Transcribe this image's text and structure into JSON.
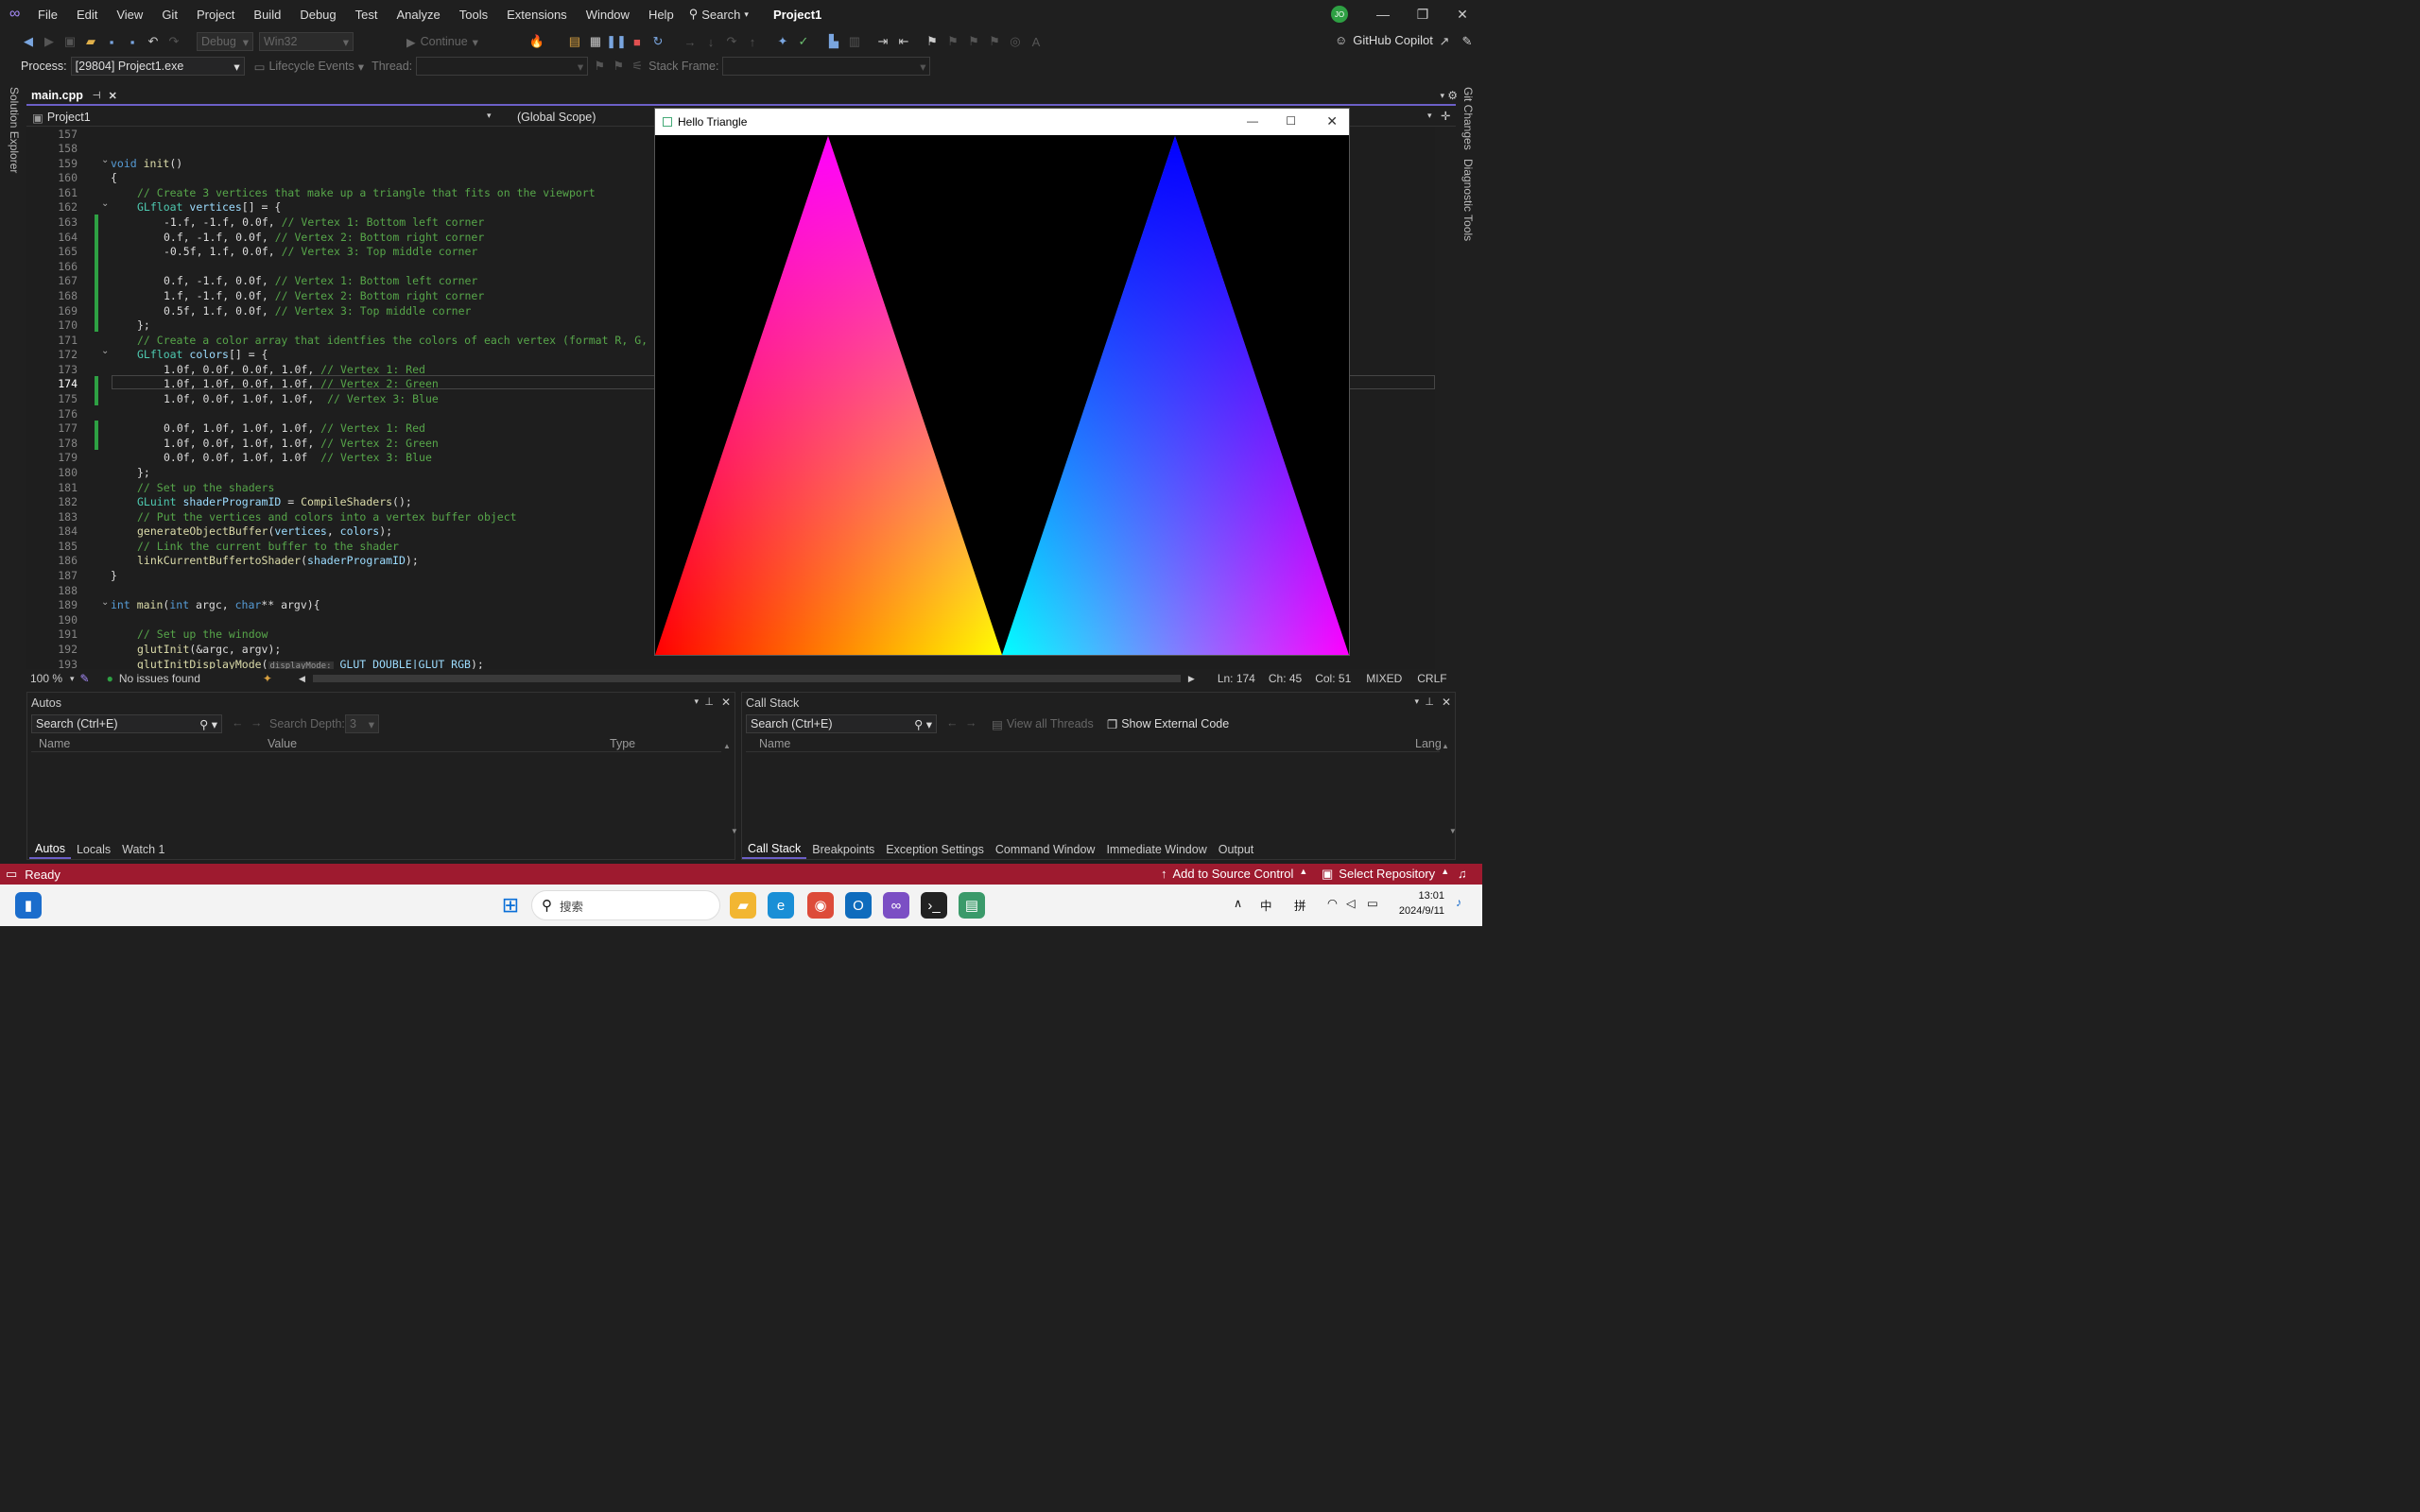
{
  "menu": [
    "File",
    "Edit",
    "View",
    "Git",
    "Project",
    "Build",
    "Debug",
    "Test",
    "Analyze",
    "Tools",
    "Extensions",
    "Window",
    "Help"
  ],
  "search_label": "Search",
  "project_title": "Project1",
  "user_initials": "JO",
  "toolbar": {
    "config": "Debug",
    "platform": "Win32",
    "continue": "Continue",
    "copilot": "GitHub Copilot"
  },
  "debugbar": {
    "process_label": "Process:",
    "process_value": "[29804] Project1.exe",
    "lifecycle": "Lifecycle Events",
    "thread_label": "Thread:",
    "stackframe_label": "Stack Frame:"
  },
  "side": {
    "left": "Solution Explorer",
    "right1": "Git Changes",
    "right2": "Diagnostic Tools"
  },
  "tab": {
    "file": "main.cpp"
  },
  "nav": {
    "project": "Project1",
    "scope": "(Global Scope)"
  },
  "code": {
    "lines": [
      "157",
      "158",
      "159",
      "160",
      "161",
      "162",
      "163",
      "164",
      "165",
      "166",
      "167",
      "168",
      "169",
      "170",
      "171",
      "172",
      "173",
      "174",
      "175",
      "176",
      "177",
      "178",
      "179",
      "180",
      "181",
      "182",
      "183",
      "184",
      "185",
      "186",
      "187",
      "188",
      "189",
      "190",
      "191",
      "192",
      "193"
    ],
    "l159": "init",
    "l161": "// Create 3 vertices that make up a triangle that fits on the viewport",
    "l162": "vertices",
    "l163": "-1.f, -1.f, 0.0f, ",
    "l163c": "// Vertex 1: Bottom left corner",
    "l164": "0.f, -1.f, 0.0f, ",
    "l164c": "// Vertex 2: Bottom right corner",
    "l165": "-0.5f, 1.f, 0.0f, ",
    "l165c": "// Vertex 3: Top middle corner",
    "l167": "0.f, -1.f, 0.0f, ",
    "l167c": "// Vertex 1: Bottom left corner",
    "l168": "1.f, -1.f, 0.0f, ",
    "l168c": "// Vertex 2: Bottom right corner",
    "l169": "0.5f, 1.f, 0.0f, ",
    "l169c": "// Vertex 3: Top middle corner",
    "l171": "// Create a color array that identfies the colors of each vertex (format R, G,",
    "l172": "colors",
    "l173": "1.0f, 0.0f, 0.0f, 1.0f, ",
    "l173c": "// Vertex 1: Red",
    "l174": "1.0f, 1.0f, 0.0f, 1.0f, ",
    "l174c": "// Vertex 2: Green",
    "l175": "1.0f, 0.0f, 1.0f, 1.0f,  ",
    "l175c": "// Vertex 3: Blue",
    "l177": "0.0f, 1.0f, 1.0f, 1.0f, ",
    "l177c": "// Vertex 1: Red",
    "l178": "1.0f, 0.0f, 1.0f, 1.0f, ",
    "l178c": "// Vertex 2: Green",
    "l179": "0.0f, 0.0f, 1.0f, 1.0f  ",
    "l179c": "// Vertex 3: Blue",
    "l181": "// Set up the shaders",
    "l182a": "shaderProgramID",
    "l182b": "CompileShaders",
    "l183": "// Put the vertices and colors into a vertex buffer object",
    "l184": "generateObjectBuffer",
    "l185": "// Link the current buffer to the shader",
    "l186": "linkCurrentBuffertoShader",
    "l189": "main",
    "l191": "// Set up the window",
    "l192": "glutInit",
    "l193": "glutInitDisplayMode",
    "l193hint": "displayMode:",
    "l193arg": "GLUT_DOUBLE|GLUT_RGB"
  },
  "editor_status": {
    "zoom": "100 %",
    "issues": "No issues found",
    "ln": "Ln: 174",
    "ch": "Ch: 45",
    "col": "Col: 51",
    "mixed": "MIXED",
    "crlf": "CRLF"
  },
  "glwindow": {
    "title": "Hello Triangle"
  },
  "autos": {
    "title": "Autos",
    "search": "Search (Ctrl+E)",
    "depth_label": "Search Depth:",
    "depth": "3",
    "cols": [
      "Name",
      "Value",
      "Type"
    ],
    "tabs": [
      "Autos",
      "Locals",
      "Watch 1"
    ]
  },
  "callstack": {
    "title": "Call Stack",
    "search": "Search (Ctrl+E)",
    "view_threads": "View all Threads",
    "show_external": "Show External Code",
    "cols": [
      "Name",
      "Lang"
    ],
    "tabs": [
      "Call Stack",
      "Breakpoints",
      "Exception Settings",
      "Command Window",
      "Immediate Window",
      "Output"
    ]
  },
  "status": {
    "ready": "Ready",
    "source": "Add to Source Control",
    "repo": "Select Repository"
  },
  "taskbar": {
    "search": "搜索",
    "ime1": "中",
    "ime2": "拼",
    "time": "13:01",
    "date": "2024/9/11"
  }
}
